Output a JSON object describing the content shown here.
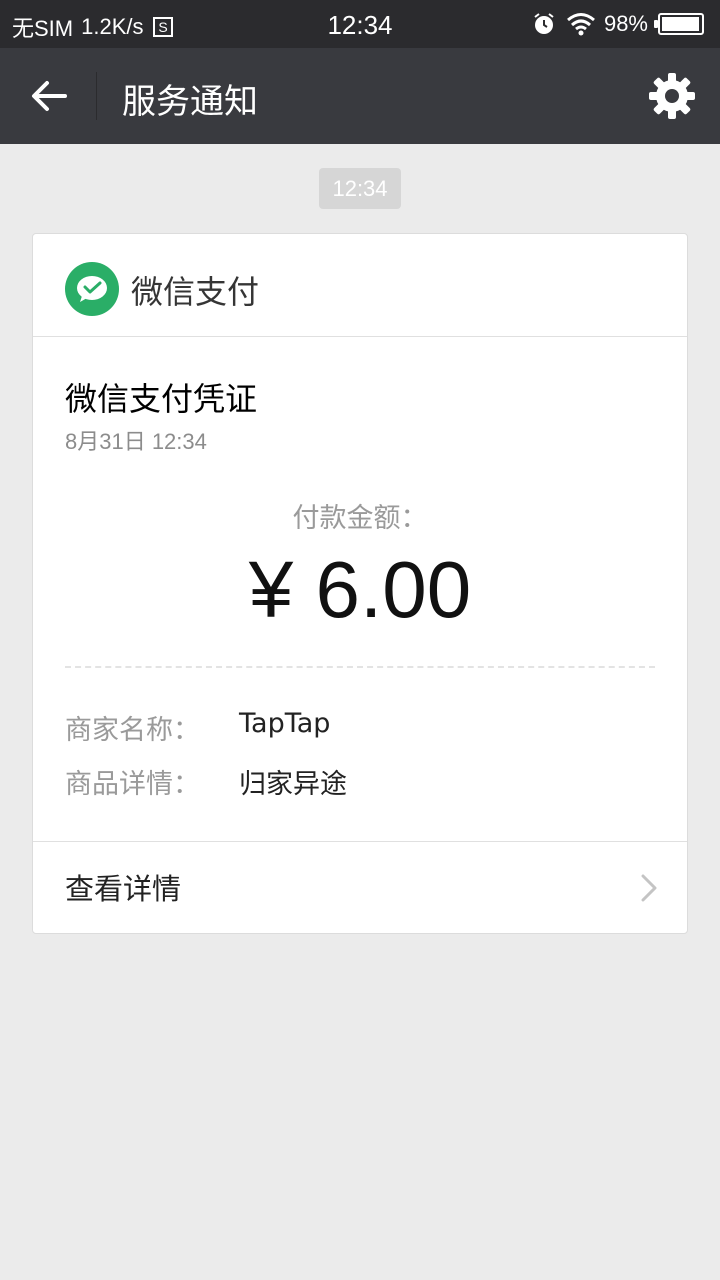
{
  "status_bar": {
    "carrier": "无SIM",
    "net_speed": "1.2K/s",
    "sim_icon": "sim-card-icon",
    "time": "12:34",
    "alarm_icon": "alarm-clock-icon",
    "wifi_icon": "wifi-icon",
    "battery_percent": "98%",
    "battery_level": 0.98
  },
  "nav": {
    "back_icon": "arrow-left-icon",
    "title": "服务通知",
    "settings_icon": "gear-icon"
  },
  "timestamp_chip": "12:34",
  "card": {
    "brand_icon": "wechat-pay-icon",
    "brand_name": "微信支付",
    "title": "微信支付凭证",
    "date": "8月31日  12:34",
    "amount_label": "付款金额：",
    "amount": "¥ 6.00",
    "details": [
      {
        "label": "商家名称：",
        "value": "TapTap"
      },
      {
        "label": "商品详情：",
        "value": "归家异途"
      }
    ],
    "view_details_label": "查看详情",
    "chevron_icon": "chevron-right-icon"
  },
  "colors": {
    "status_bar_bg": "#2b2b2e",
    "nav_bg": "#393a3f",
    "page_bg": "#ebebeb",
    "wechat_green": "#2aae67"
  }
}
